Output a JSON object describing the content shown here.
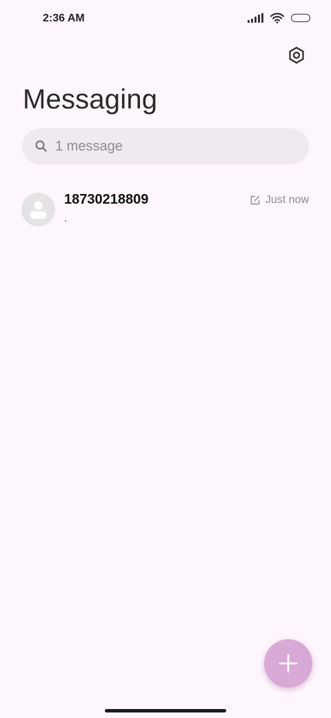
{
  "status_bar": {
    "time": "2:36 AM",
    "icons": [
      "signal-icon",
      "wifi-icon",
      "battery-icon"
    ]
  },
  "header": {
    "title": "Messaging",
    "settings_icon": "settings-icon"
  },
  "search": {
    "placeholder": "1 message",
    "value": ""
  },
  "conversations": [
    {
      "name": "18730218809",
      "preview": ".",
      "timestamp": "Just now",
      "status_icon": "draft-icon"
    }
  ],
  "fab": {
    "icon": "plus-icon"
  },
  "colors": {
    "background": "#fdf6fc",
    "search_bg": "#f0eaf0",
    "fab": "#d9a9d5",
    "avatar_bg": "#e6e3e7"
  }
}
